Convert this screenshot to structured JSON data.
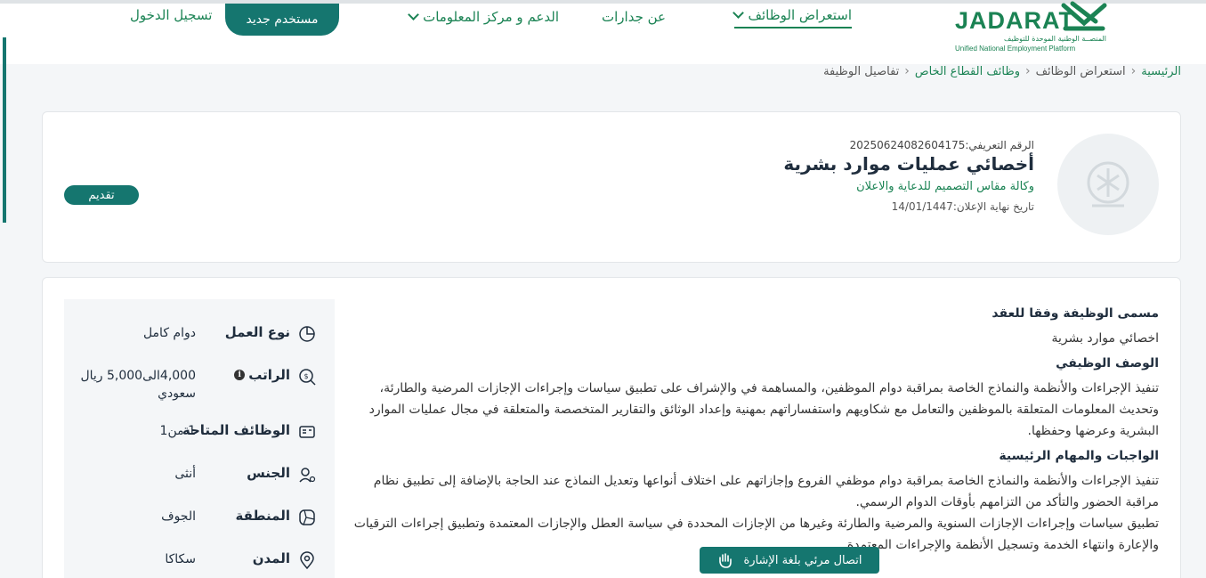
{
  "header": {
    "logo": {
      "word": "JADARAT",
      "arabic": "المنصــة الوطنية الموحدة للتوظيف",
      "english": "Unified National Employment Platform"
    },
    "nav": [
      {
        "label": "استعراض الوظائف",
        "active": true,
        "dropdown": true
      },
      {
        "label": "عن جدارات",
        "active": false,
        "dropdown": false
      },
      {
        "label": "الدعم و مركز المعلومات",
        "active": false,
        "dropdown": true
      }
    ],
    "new_user_label": "مستخدم جديد",
    "login_label": "تسجيل الدخول"
  },
  "breadcrumb": {
    "home": "الرئيسية",
    "jobs": "استعراض الوظائف",
    "private": "وظائف القطاع الخاص",
    "current": "تفاصيل الوظيفة"
  },
  "job": {
    "id_label": "الرقم التعريفي:",
    "id_value": "20250624082604175",
    "title": "أخصائي عمليات موارد بشرية",
    "company": "وكالة مقاس التصميم للدعاية والاعلان",
    "deadline_label": "تاريخ نهاية الإعلان:",
    "deadline_value": "14/01/1447",
    "apply_label": "تقديم"
  },
  "details": {
    "contract_title_heading": "مسمى الوظيفة وفقا للعقد",
    "contract_title": "اخصائي موارد بشرية",
    "description_heading": "الوصف الوظيفي",
    "description": "تنفيذ الإجراءات والأنظمة والنماذج الخاصة بمراقبة دوام الموظفين، والمساهمة في والإشراف على تطبيق سياسات وإجراءات الإجازات المرضية والطارئة، وتحديث المعلومات المتعلقة بالموظفين والتعامل مع شكاويهم واستفساراتهم بمهنية وإعداد الوثائق والتقارير المتخصصة والمتعلقة في مجال عمليات الموارد البشرية وعرضها وحفظها.",
    "duties_heading": "الواجبات والمهام الرئيسية",
    "duties_1": "تنفيذ الإجراءات والأنظمة والنماذج الخاصة بمراقبة دوام موظفي الفروع وإجازاتهم على اختلاف أنواعها وتعديل النماذج عند الحاجة بالإضافة إلى تطبيق نظام مراقبة الحضور والتأكد من التزامهم بأوقات الدوام الرسمي.",
    "duties_2": "تطبيق سياسات وإجراءات الإجازات السنوية والمرضية والطارئة وغيرها من الإجازات المحددة في سياسة العطل والإجازات المعتمدة وتطبيق إجراءات الترقيات والإعارة وانتهاء الخدمة وتسجيل الأنظمة والإجراءات المعتمدة"
  },
  "summary": [
    {
      "key": "نوع العمل",
      "value": "دوام كامل",
      "icon": "pie-chart-icon"
    },
    {
      "key": "الراتب",
      "value": "4,000الى5,000 ريال سعودي",
      "icon": "money-search-icon",
      "info": "i"
    },
    {
      "key": "الوظائف المتاحة",
      "value": "1 من1",
      "icon": "id-card-icon"
    },
    {
      "key": "الجنس",
      "value": "أنثى",
      "icon": "gender-icon"
    },
    {
      "key": "المنطقة",
      "value": "الجوف",
      "icon": "map-icon"
    },
    {
      "key": "المدن",
      "value": "سكاكا",
      "icon": "location-pin-icon"
    }
  ],
  "sign_language_label": "اتصال مرئي بلغة الإشارة",
  "colors": {
    "brand": "#1b8354",
    "button": "#15766f",
    "background": "#f4f6f8"
  }
}
